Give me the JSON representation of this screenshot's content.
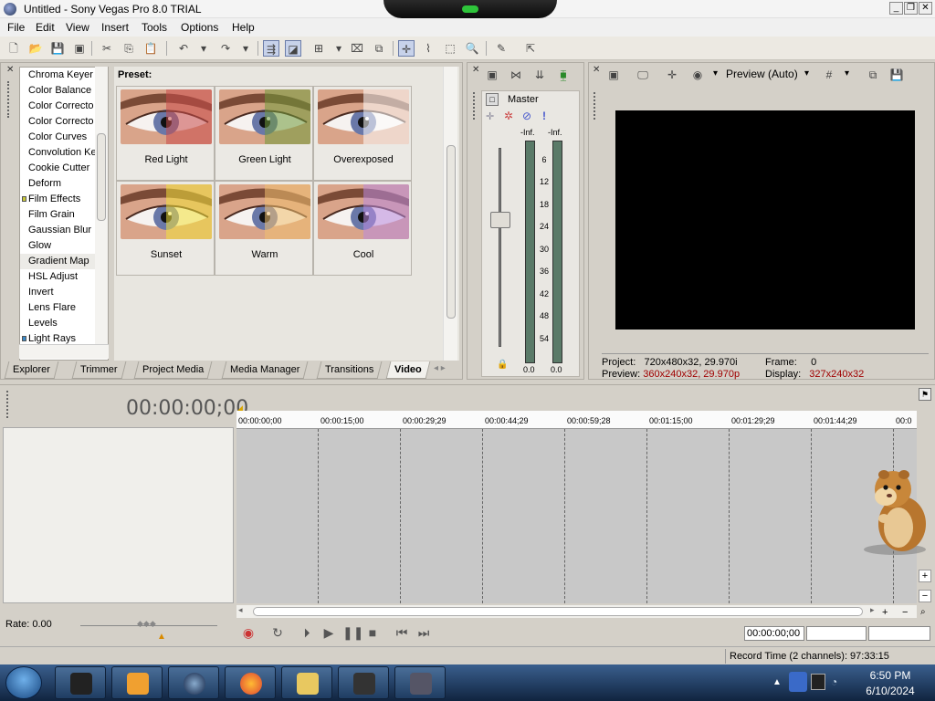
{
  "window": {
    "title": "Untitled - Sony Vegas Pro 8.0 TRIAL"
  },
  "menu": [
    "File",
    "Edit",
    "View",
    "Insert",
    "Tools",
    "Options",
    "Help"
  ],
  "explorer": {
    "effects": [
      "Chroma Keyer",
      "Color Balance",
      "Color Correcto",
      "Color Correcto",
      "Color Curves",
      "Convolution Ke",
      "Cookie Cutter",
      "Deform",
      "Film Effects",
      "Film Grain",
      "Gaussian Blur",
      "Glow",
      "Gradient Map",
      "HSL Adjust",
      "Invert",
      "Lens Flare",
      "Levels",
      "Light Rays"
    ],
    "preset_label": "Preset:",
    "presets": [
      "Red  Light",
      "Green  Light",
      "Overexposed",
      "Sunset",
      "Warm",
      "Cool"
    ],
    "preset_tints": [
      "#c94a4a",
      "#6f9a3a",
      "#ffffff",
      "#f2e23a",
      "#f0c070",
      "#b98ae0"
    ],
    "tabs": [
      "Explorer",
      "Trimmer",
      "Project Media",
      "Media Manager",
      "Transitions",
      "Video"
    ]
  },
  "master": {
    "label": "Master",
    "left_peak": "-Inf.",
    "right_peak": "-Inf.",
    "scale": [
      "6",
      "12",
      "18",
      "24",
      "30",
      "36",
      "42",
      "48",
      "54"
    ],
    "left_value": "0.0",
    "right_value": "0.0"
  },
  "preview": {
    "mode": "Preview (Auto)",
    "project_label": "Project:",
    "project_value": "720x480x32, 29.970i",
    "preview_label": "Preview:",
    "preview_value": "360x240x32, 29.970p",
    "frame_label": "Frame:",
    "frame_value": "0",
    "display_label": "Display:",
    "display_value": "327x240x32"
  },
  "timeline": {
    "timecode": "00:00:00;00",
    "ruler": [
      "00:00:00;00",
      "00:00:15;00",
      "00:00:29;29",
      "00:00:44;29",
      "00:00:59;28",
      "00:01:15;00",
      "00:01:29;29",
      "00:01:44;29",
      "00:0"
    ],
    "rate": "Rate: 0.00",
    "cursor_timecode": "00:00:00;00"
  },
  "status": {
    "record_time": "Record Time (2 channels): 97:33:15"
  },
  "taskbar": {
    "time": "6:50 PM",
    "date": "6/10/2024"
  }
}
